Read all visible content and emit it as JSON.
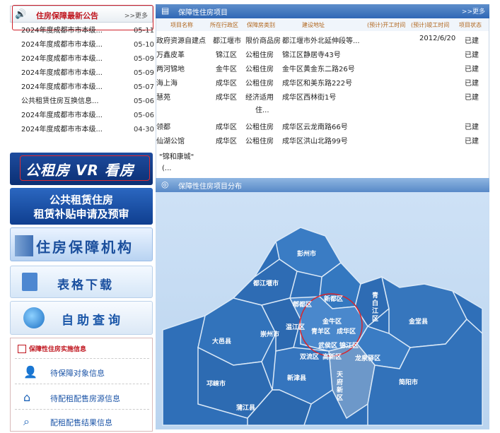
{
  "notices": {
    "title": "住房保障最新公告",
    "more": ">>更多",
    "items": [
      {
        "title": "2024年度成都市市本级...",
        "date": "05-11"
      },
      {
        "title": "2024年度成都市市本级...",
        "date": "05-10"
      },
      {
        "title": "2024年度成都市市本级...",
        "date": "05-09"
      },
      {
        "title": "2024年度成都市市本级...",
        "date": "05-09"
      },
      {
        "title": "2024年度成都市市本级...",
        "date": "05-07"
      },
      {
        "title": "公共租赁住房互换信息...",
        "date": "05-06"
      },
      {
        "title": "2024年度成都市市本级...",
        "date": "05-06"
      },
      {
        "title": "2024年度成都市市本级...",
        "date": "04-30"
      }
    ]
  },
  "banners": {
    "vr": "公租房 VR 看房",
    "subsidy_line1": "公共租赁住房",
    "subsidy_line2": "租赁补贴申请及预审",
    "org": "住房保障机构",
    "download": "表格下载",
    "query": "自助查询"
  },
  "info_panel": {
    "title": "保障性住房实施信息",
    "items": [
      "待保障对象信息",
      "待配租配售房源信息",
      "配租配售结果信息"
    ]
  },
  "projects": {
    "title": "保障性住房项目",
    "more": ">>更多",
    "columns": [
      "项目名称",
      "所在行政区",
      "保障房类别",
      "建设地址",
      "(预计)开工时间",
      "(预计)竣工时间",
      "项目状态"
    ],
    "rows": [
      {
        "name": "政府资源自建点",
        "district": "都江堰市",
        "type": "限价商品房",
        "address": "都江堰市外北延伸段等...",
        "start": "",
        "finish": "2012/6/20",
        "status": "已建"
      },
      {
        "name": "万鑫皮革",
        "district": "锦江区",
        "type": "公租住房",
        "address": "锦江区静居寺43号",
        "start": "",
        "finish": "",
        "status": "已建"
      },
      {
        "name": "两河锦地",
        "district": "金牛区",
        "type": "公租住房",
        "address": "金牛区黄金东二路26号",
        "start": "",
        "finish": "",
        "status": "已建"
      },
      {
        "name": "海上海",
        "district": "成华区",
        "type": "公租住房",
        "address": "成华区和美东路222号",
        "start": "",
        "finish": "",
        "status": "已建"
      },
      {
        "name": "慧苑",
        "district": "成华区",
        "type": "经济适用",
        "type2": "住...",
        "address": "成华区西林街1号",
        "start": "",
        "finish": "",
        "status": "已建"
      },
      {
        "name": "领都",
        "district": "成华区",
        "type": "公租住房",
        "address": "成华区云龙南路66号",
        "start": "",
        "finish": "",
        "status": "已建"
      },
      {
        "name": "仙湖公馆",
        "district": "成华区",
        "type": "公租住房",
        "address": "成华区洪山北路99号",
        "start": "",
        "finish": "",
        "status": "已建"
      }
    ],
    "extra_line1": "\"锦和康城\"",
    "extra_line2": "(..."
  },
  "map": {
    "title": "保障性住房项目分布",
    "labels": [
      "彭州市",
      "都江堰市",
      "新都区",
      "郫都区",
      "青白江区",
      "金牛区",
      "温江区",
      "青羊区",
      "成华区",
      "崇州市",
      "金堂县",
      "大邑县",
      "武侯区",
      "锦江区",
      "双流区",
      "高新区",
      "龙泉驿区",
      "邛崃市",
      "新津县",
      "天府新区",
      "简阳市",
      "蒲江县"
    ]
  }
}
